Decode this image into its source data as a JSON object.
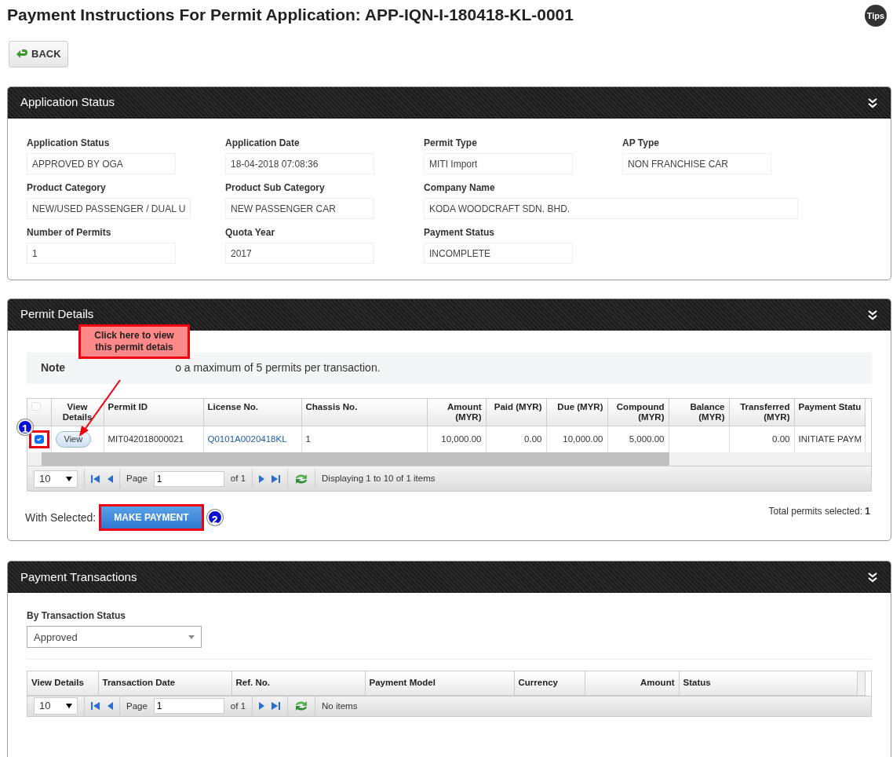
{
  "page_title": "Payment Instructions For Permit Application: APP-IQN-I-180418-KL-0001",
  "tips_button": "Tips",
  "back_button": "BACK",
  "application_status": {
    "title": "Application Status",
    "rows": [
      [
        {
          "label": "Application Status",
          "value": "APPROVED BY OGA",
          "kind": "normal"
        },
        {
          "label": "Application Date",
          "value": "18-04-2018 07:08:36",
          "kind": "normal"
        },
        {
          "label": "Permit Type",
          "value": "MITI Import",
          "kind": "normal"
        },
        {
          "label": "AP Type",
          "value": "NON FRANCHISE CAR",
          "kind": "normal"
        }
      ],
      [
        {
          "label": "Product Category",
          "value": "NEW/USED PASSENGER / DUAL U",
          "kind": "normal"
        },
        {
          "label": "Product Sub Category",
          "value": "NEW PASSENGER CAR",
          "kind": "normal"
        },
        {
          "label": "Company Name",
          "value": "KODA WOODCRAFT SDN. BHD.",
          "kind": "wide"
        }
      ],
      [
        {
          "label": "Number of Permits",
          "value": "1",
          "kind": "normal"
        },
        {
          "label": "Quota Year",
          "value": "2017",
          "kind": "normal"
        },
        {
          "label": "Payment Status",
          "value": "INCOMPLETE",
          "kind": "normal"
        }
      ]
    ]
  },
  "permit_details": {
    "title": "Permit Details",
    "note_label": "Note",
    "note_text": "o a maximum of 5 permits per transaction.",
    "callout": "Click here to view this permit detais",
    "select_all_checked": false,
    "columns": [
      "",
      "View Details",
      "Permit ID",
      "License No.",
      "Chassis No.",
      "Amount (MYR)",
      "Paid (MYR)",
      "Due (MYR)",
      "Compound (MYR)",
      "Balance (MYR)",
      "Transferred (MYR)",
      "Payment Statu"
    ],
    "rows": [
      {
        "checked": true,
        "cells": [
          "",
          "View",
          "MIT042018000021",
          "Q0101A0020418KL",
          "1",
          "10,000.00",
          "0.00",
          "10,000.00",
          "5,000.00",
          "",
          "0.00",
          "INITIATE PAYM"
        ]
      }
    ],
    "pager": {
      "page_size": "10",
      "page_label": "Page",
      "page": "1",
      "of": "of 1",
      "info": "Displaying 1 to 10 of 1 items"
    },
    "with_selected": "With Selected:",
    "make_payment": "MAKE PAYMENT",
    "step_markers": [
      "1",
      "2"
    ],
    "total_label": "Total permits selected:",
    "total_value": "1"
  },
  "payment_transactions": {
    "title": "Payment Transactions",
    "filter_label": "By Transaction Status",
    "filter_value": "Approved",
    "columns": [
      "View Details",
      "Transaction Date",
      "Ref. No.",
      "Payment Model",
      "Currency",
      "Amount",
      "Status"
    ],
    "pager": {
      "page_size": "10",
      "page_label": "Page",
      "page": "1",
      "of": "of 1",
      "info": "No items"
    }
  }
}
